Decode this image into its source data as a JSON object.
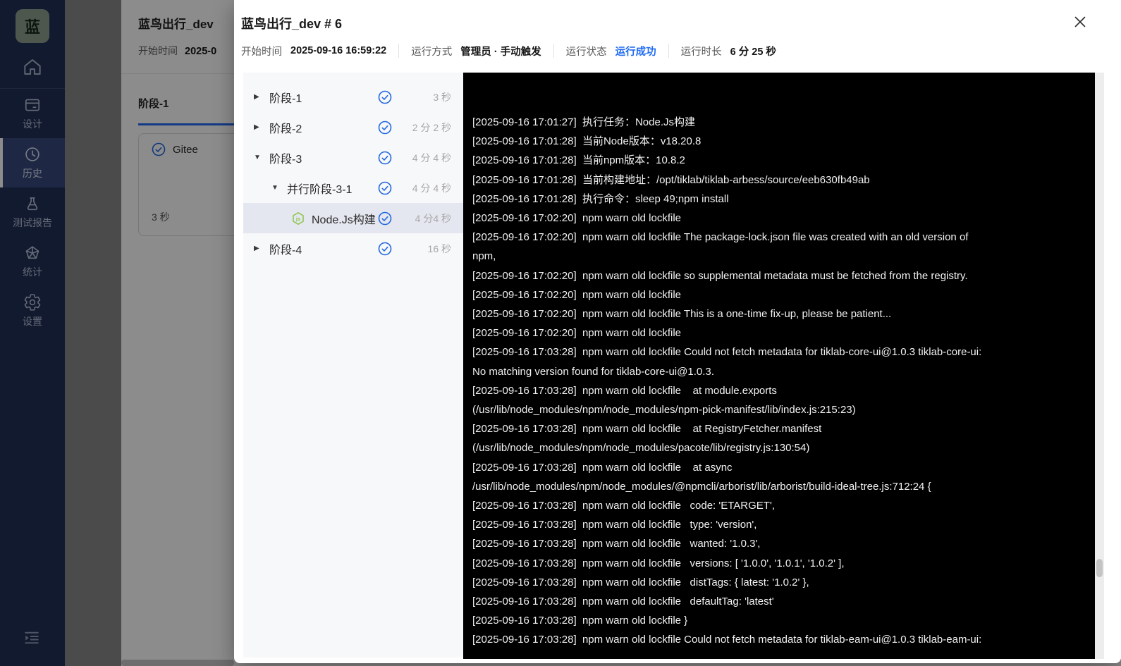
{
  "colors": {
    "accent_blue": "#1f6bf2",
    "check_blue": "#2368e0",
    "node_green": "#8bc34a",
    "sidebar_bg": "#213158",
    "console_bg": "#000000",
    "tree_panel_bg": "#f7f8fa",
    "selected_row_bg": "#e4e7ef"
  },
  "sidebar": {
    "logo_text": "蓝",
    "items": [
      {
        "label": "设计"
      },
      {
        "label": "历史",
        "active": true
      },
      {
        "label": "测试报告"
      },
      {
        "label": "统计"
      },
      {
        "label": "设置"
      }
    ]
  },
  "background_page": {
    "title": "蓝鸟出行_dev",
    "start_time_label": "开始时间",
    "start_time_value": "2025-0",
    "tab_label": "阶段-1",
    "card": {
      "task_name": "Gitee",
      "duration": "3 秒"
    }
  },
  "modal": {
    "title": "蓝鸟出行_dev # 6",
    "info": {
      "start_time": {
        "label": "开始时间",
        "value": "2025-09-16 16:59:22"
      },
      "run_mode": {
        "label": "运行方式",
        "value": "管理员 · 手动触发"
      },
      "run_status": {
        "label": "运行状态",
        "value": "运行成功"
      },
      "run_duration": {
        "label": "运行时长",
        "value": "6 分 25 秒"
      }
    },
    "stages": [
      {
        "caret": "▶",
        "label": "阶段-1",
        "duration": "3 秒"
      },
      {
        "caret": "▶",
        "label": "阶段-2",
        "duration": "2 分 2 秒"
      },
      {
        "caret": "▼",
        "label": "阶段-3",
        "duration": "4 分 4 秒"
      },
      {
        "caret": "▼",
        "label": "并行阶段-3-1",
        "duration": "4 分 4 秒"
      },
      {
        "caret": "",
        "label": "Node.Js构建",
        "duration": "4 分4 秒"
      },
      {
        "caret": "▶",
        "label": "阶段-4",
        "duration": "16 秒"
      }
    ],
    "console_lines": [
      "[2025-09-16 17:01:27]  执行任务：Node.Js构建",
      "[2025-09-16 17:01:28]  当前Node版本：v18.20.8",
      "[2025-09-16 17:01:28]  当前npm版本：10.8.2",
      "[2025-09-16 17:01:28]  当前构建地址：/opt/tiklab/tiklab-arbess/source/eeb630fb49ab",
      "[2025-09-16 17:01:28]  执行命令：sleep 49;npm install",
      "[2025-09-16 17:02:20]  npm warn old lockfile",
      "[2025-09-16 17:02:20]  npm warn old lockfile The package-lock.json file was created with an old version of",
      "npm,",
      "[2025-09-16 17:02:20]  npm warn old lockfile so supplemental metadata must be fetched from the registry.",
      "[2025-09-16 17:02:20]  npm warn old lockfile",
      "[2025-09-16 17:02:20]  npm warn old lockfile This is a one-time fix-up, please be patient...",
      "[2025-09-16 17:02:20]  npm warn old lockfile",
      "[2025-09-16 17:03:28]  npm warn old lockfile Could not fetch metadata for tiklab-core-ui@1.0.3 tiklab-core-ui:",
      "No matching version found for tiklab-core-ui@1.0.3.",
      "[2025-09-16 17:03:28]  npm warn old lockfile    at module.exports",
      "(/usr/lib/node_modules/npm/node_modules/npm-pick-manifest/lib/index.js:215:23)",
      "[2025-09-16 17:03:28]  npm warn old lockfile    at RegistryFetcher.manifest",
      "(/usr/lib/node_modules/npm/node_modules/pacote/lib/registry.js:130:54)",
      "[2025-09-16 17:03:28]  npm warn old lockfile    at async",
      "/usr/lib/node_modules/npm/node_modules/@npmcli/arborist/lib/arborist/build-ideal-tree.js:712:24 {",
      "[2025-09-16 17:03:28]  npm warn old lockfile   code: 'ETARGET',",
      "[2025-09-16 17:03:28]  npm warn old lockfile   type: 'version',",
      "[2025-09-16 17:03:28]  npm warn old lockfile   wanted: '1.0.3',",
      "[2025-09-16 17:03:28]  npm warn old lockfile   versions: [ '1.0.0', '1.0.1', '1.0.2' ],",
      "[2025-09-16 17:03:28]  npm warn old lockfile   distTags: { latest: '1.0.2' },",
      "[2025-09-16 17:03:28]  npm warn old lockfile   defaultTag: 'latest'",
      "[2025-09-16 17:03:28]  npm warn old lockfile }",
      "[2025-09-16 17:03:28]  npm warn old lockfile Could not fetch metadata for tiklab-eam-ui@1.0.3 tiklab-eam-ui:"
    ]
  }
}
